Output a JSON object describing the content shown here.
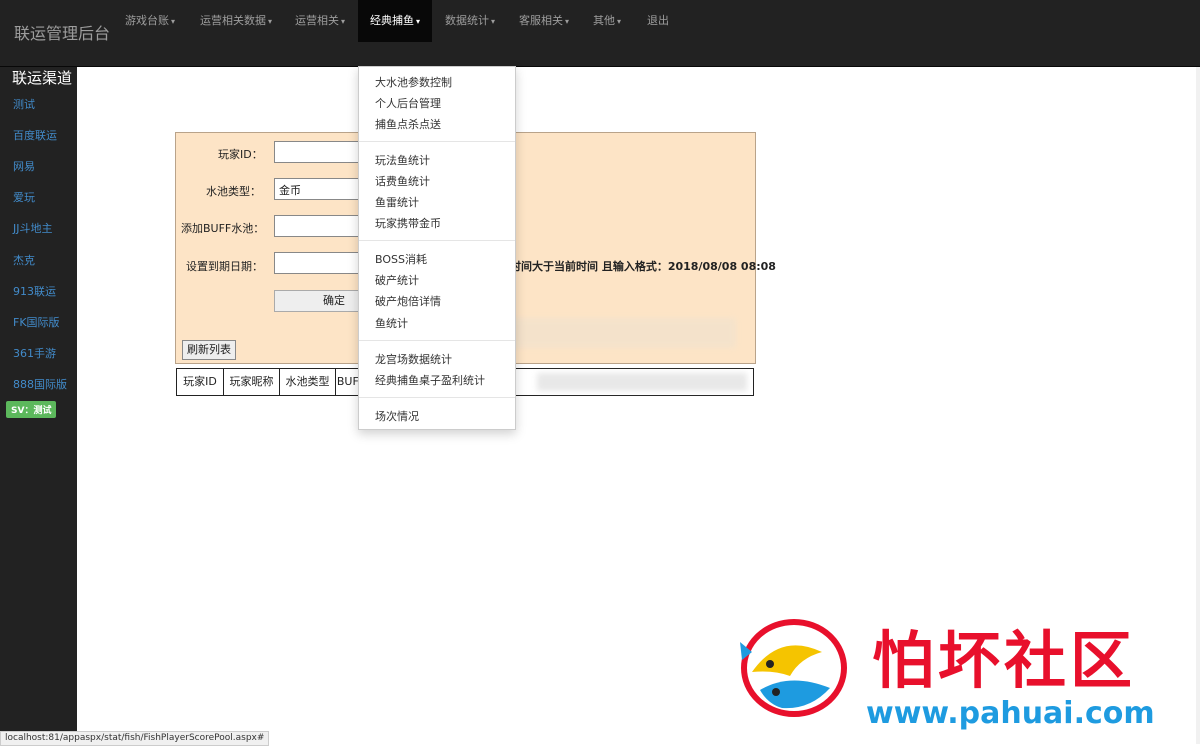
{
  "app": {
    "title": "联运管理后台"
  },
  "nav": {
    "items": [
      {
        "label": "游戏台账",
        "caret": true
      },
      {
        "label": "运营相关数据",
        "caret": true
      },
      {
        "label": "运营相关",
        "caret": true
      },
      {
        "label": "经典捕鱼",
        "caret": true,
        "active": true
      },
      {
        "label": "数据统计",
        "caret": true
      },
      {
        "label": "客服相关",
        "caret": true
      },
      {
        "label": "其他",
        "caret": true
      },
      {
        "label": "退出",
        "caret": false
      }
    ]
  },
  "sidebar": {
    "title": "联运渠道",
    "items": [
      "测试",
      "百度联运",
      "网易",
      "爱玩",
      "JJ斗地主",
      "杰克",
      "913联运",
      "FK国际版",
      "361手游",
      "888国际版"
    ],
    "badge": "SV：测试"
  },
  "dropdown": {
    "groups": [
      [
        "大水池参数控制",
        "个人后台管理",
        "捕鱼点杀点送"
      ],
      [
        "玩法鱼统计",
        "话费鱼统计",
        "鱼雷统计",
        "玩家携带金币"
      ],
      [
        "BOSS消耗",
        "破产统计",
        "破产炮倍详情",
        "鱼统计"
      ],
      [
        "龙宫场数据统计",
        "经典捕鱼桌子盈利统计"
      ],
      [
        "场次情况"
      ]
    ]
  },
  "form": {
    "player_id_label": "玩家ID：",
    "player_id_value": "",
    "pool_type_label": "水池类型：",
    "pool_type_value": "金币",
    "buff_pool_label": "添加BUFF水池：",
    "buff_pool_value": "",
    "expire_label": "设置到期日期：",
    "expire_value": "",
    "hint": "时间大于当前时间 且输入格式：2018/08/08 08:08",
    "submit_label": "确定",
    "refresh_label": "刷新列表"
  },
  "table": {
    "columns": [
      "玩家ID",
      "玩家昵称",
      "水池类型",
      "BUFF"
    ]
  },
  "statusbar": {
    "url": "localhost:81/appaspx/stat/fish/FishPlayerScorePool.aspx#"
  },
  "watermark": {
    "title": "怕坏社区",
    "url": "www.pahuai.com"
  },
  "colors": {
    "navbar": "#222222",
    "panel": "#fde4c6",
    "link": "#428bca",
    "badge": "#5cb85c",
    "watermark_red": "#e8102c",
    "watermark_blue": "#1e9be0"
  }
}
